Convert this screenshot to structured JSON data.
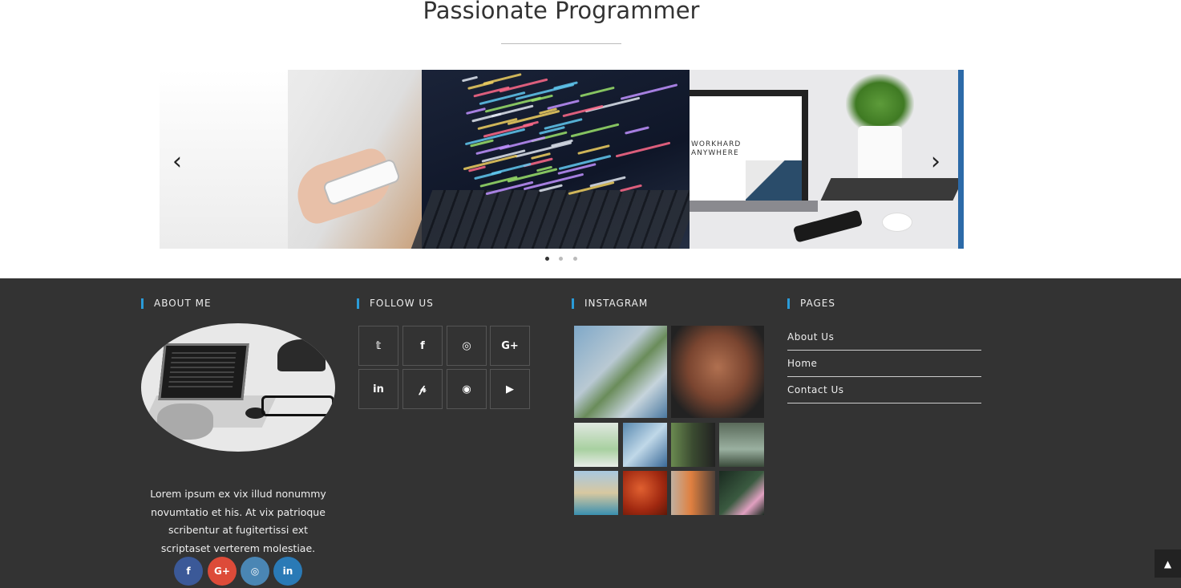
{
  "section": {
    "title": "Passionate Programmer"
  },
  "carousel": {
    "prev_icon": "chevron-left-icon",
    "next_icon": "chevron-right-icon",
    "dots": 3,
    "active_dot": 1,
    "slide3_text": "WORKHARD\nANYWHERE"
  },
  "footer": {
    "about": {
      "title": "ABOUT ME",
      "text": "Lorem ipsum ex vix illud nonummy novumtatio et his. At vix patrioque scribentur at fugitertissi ext scriptaset verterem molestiae.",
      "social": [
        {
          "icon": "facebook-icon",
          "glyph": "f",
          "color": "#3b5998"
        },
        {
          "icon": "google-plus-icon",
          "glyph": "G+",
          "color": "#dd4b39"
        },
        {
          "icon": "instagram-icon",
          "glyph": "◎",
          "color": "#4a86b4"
        },
        {
          "icon": "linkedin-icon",
          "glyph": "in",
          "color": "#2a7ab6"
        }
      ]
    },
    "follow": {
      "title": "FOLLOW US",
      "icons": [
        {
          "icon": "twitter-icon",
          "glyph": "𝕥"
        },
        {
          "icon": "facebook-icon",
          "glyph": "f"
        },
        {
          "icon": "instagram-icon",
          "glyph": "◎"
        },
        {
          "icon": "google-plus-icon",
          "glyph": "G+"
        },
        {
          "icon": "linkedin-icon",
          "glyph": "in"
        },
        {
          "icon": "pinterest-icon",
          "glyph": "𝓅"
        },
        {
          "icon": "github-icon",
          "glyph": "◉"
        },
        {
          "icon": "youtube-icon",
          "glyph": "▶"
        }
      ]
    },
    "instagram": {
      "title": "INSTAGRAM"
    },
    "pages": {
      "title": "PAGES",
      "links": [
        "About Us",
        "Home",
        "Contact Us"
      ]
    }
  },
  "back_to_top_icon": "chevron-up-icon"
}
